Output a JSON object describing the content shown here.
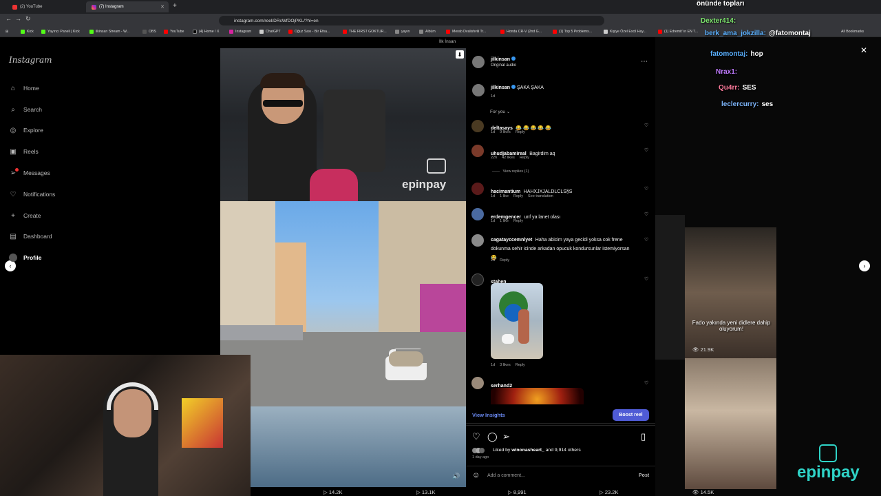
{
  "browser": {
    "tabs": [
      {
        "label": "(2) YouTube",
        "active": false
      },
      {
        "label": "(7) Instagram",
        "active": true
      }
    ],
    "url": "instagram.com/reel/DRcWfDOjPKL/?hl=en",
    "bookmarks": [
      "Kick",
      "Yayıncı Paneli | Kick",
      "ilkinsan Stream - W...",
      "OBS",
      "YouTube",
      "(4) Home / X",
      "Instagram",
      "ChatGPT",
      "Oğuz Sası - Bir Efsa...",
      "THE FIRST GOKTUR...",
      "yayın",
      "Albüm",
      "Merab Dvalishvili Tr...",
      "Honda CR-V (2nd G...",
      "(1) Top 5 Problems...",
      "Kişiye Özel Excil Hay...",
      "(1) Edremit' in EN T..."
    ],
    "all_bookmarks": "All Bookmarks"
  },
  "sidebar": {
    "logo": "Instagram",
    "items": [
      {
        "label": "Home",
        "icon": "home-icon"
      },
      {
        "label": "Search",
        "icon": "search-icon"
      },
      {
        "label": "Explore",
        "icon": "compass-icon"
      },
      {
        "label": "Reels",
        "icon": "reels-icon"
      },
      {
        "label": "Messages",
        "icon": "messages-icon"
      },
      {
        "label": "Notifications",
        "icon": "heart-icon"
      },
      {
        "label": "Create",
        "icon": "plus-icon"
      },
      {
        "label": "Dashboard",
        "icon": "dashboard-icon"
      },
      {
        "label": "Profile",
        "icon": "profile-icon"
      }
    ]
  },
  "video": {
    "above_label": "İlk İnsan",
    "watermark": "epinpay"
  },
  "post": {
    "author": "jilkinsan",
    "audio": "Original audio",
    "caption_user": "jilkinsan",
    "caption": "ŞAKA ŞAKA",
    "caption_time": "1d",
    "filter": "For you"
  },
  "comments": [
    {
      "user": "deltasays",
      "text": "😂 😂 😂 😂 😂",
      "time": "1d",
      "likes": "9 likes",
      "reply": "Reply"
    },
    {
      "user": "uhudjabamireal",
      "text": "Bagirdim aq",
      "time": "22h",
      "likes": "42 likes",
      "reply": "Reply",
      "view_replies": "View replies (1)"
    },
    {
      "user": "hacimantium",
      "text": "HAHXJXJALDLCLS§S",
      "time": "1d",
      "likes": "1 like",
      "reply": "Reply",
      "translate": "See translation"
    },
    {
      "user": "erdemgencer",
      "text": "unf ya lanet olası",
      "time": "1d",
      "likes": "1 like",
      "reply": "Reply"
    },
    {
      "user": "cagatayccemnlyet",
      "text": "Haha abicim yaya gecidi yoksa cok frene dokunma sehir icinde arkadan opucuk kondursunlar istemiyorsan 😂",
      "time": "1d",
      "reply": "Reply"
    },
    {
      "user": "stahen",
      "time": "1d",
      "likes": "3 likes",
      "reply": "Reply"
    },
    {
      "user": "serhand2"
    }
  ],
  "footer": {
    "insights": "View Insights",
    "boost": "Boost reel",
    "liked_prefix": "Liked by",
    "liked_user": "winonasheart_",
    "liked_suffix": "and 9,914 others",
    "date": "1 day ago",
    "comment_placeholder": "Add a comment...",
    "post_label": "Post"
  },
  "right_side": {
    "caption_overlay": "Fado yakında yeni didlere dahip oluyorum!",
    "views": [
      "21.9K",
      "14.5K"
    ],
    "bottom_stats": [
      "14.2K",
      "13.1K",
      "8,991",
      "23.2K"
    ],
    "brand": "epinpay"
  },
  "chat": {
    "top_fragment": "önünde topları",
    "lines": [
      {
        "nick": "Dexter414:",
        "msg": "",
        "color": "#7be36b"
      },
      {
        "nick": "berk_ama_jokzilla:",
        "msg": "@fatomontaj",
        "color": "#5ab0ff"
      },
      {
        "nick": "fatomontaj:",
        "msg": "hop",
        "color": "#5ab0ff"
      },
      {
        "nick": "Nrax1:",
        "msg": "",
        "color": "#c07bff"
      },
      {
        "nick": "Qu4rr:",
        "msg": "SES",
        "color": "#ff7b9c"
      },
      {
        "nick": "leclercurry:",
        "msg": "ses",
        "color": "#7fb8ff"
      }
    ]
  }
}
